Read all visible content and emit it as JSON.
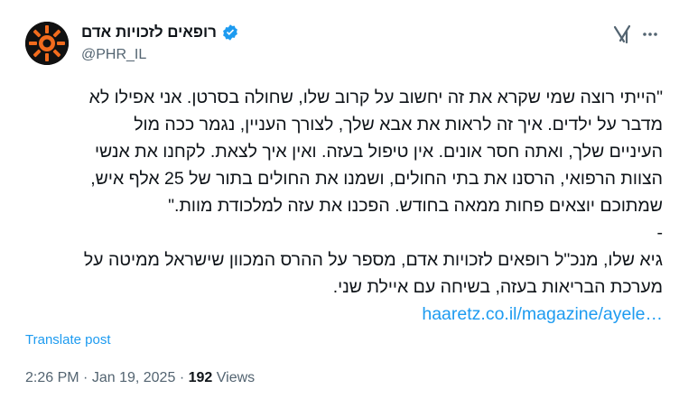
{
  "author": {
    "display_name": "רופאים לזכויות אדם",
    "handle": "@PHR_IL",
    "verified_icon": "verified-badge-icon",
    "avatar_icon": "sun-gear-logo-icon"
  },
  "header_actions": {
    "grok_icon": "grok-icon",
    "more_icon": "more-dots-icon"
  },
  "tweet": {
    "lines": [
      "\"הייתי רוצה שמי שקרא את זה יחשוב על קרוב שלו, שחולה בסרטן. אני אפילו לא",
      "מדבר על ילדים. איך זה לראות את אבא שלך, לצורך העניין, נגמר ככה מול",
      "העיניים שלך, ואתה חסר אונים. אין טיפול בעזה. ואין איך לצאת. לקחנו את אנשי",
      "הצוות הרפואי, הרסנו את בתי החולים, ושמנו את החולים בתור של 25 אלף איש,",
      "שמתוכם יוצאים פחות ממאה בחודש. הפכנו את עזה למלכודת מוות.\"",
      "-",
      "גיא שלו, מנכ\"ל רופאים לזכויות אדם, מספר על ההרס המכוון שישראל ממיטה על",
      "מערכת הבריאות בעזה, בשיחה עם איילת שני."
    ],
    "link_text": "haaretz.co.il/magazine/ayele…"
  },
  "translate_label": "Translate post",
  "meta": {
    "time": "2:26 PM",
    "separator": "·",
    "date": "Jan 19, 2025",
    "views_count": "192",
    "views_label": "Views"
  },
  "colors": {
    "link": "#1d9bf0",
    "secondary_text": "#536471",
    "primary_text": "#0f1419",
    "avatar_orange": "#f26b1d"
  }
}
